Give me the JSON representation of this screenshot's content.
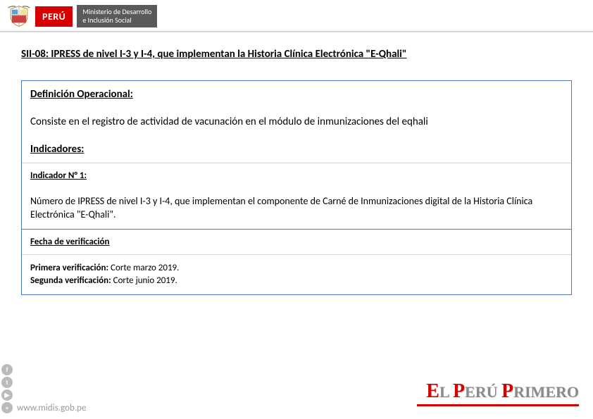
{
  "header": {
    "country": "PERÚ",
    "ministry_line1": "Ministerio de Desarrollo",
    "ministry_line2": "e Inclusión Social"
  },
  "title": "SII-08: IPRESS de nivel I-3 y I-4, que implementan la Historia Clínica Electrónica \"E-Qhali\"",
  "definicion": {
    "heading": "Definición Operacional:",
    "text": "Consiste en el registro de actividad de vacunación en el módulo de inmunizaciones del eqhali"
  },
  "indicadores": {
    "heading": "Indicadores:",
    "n1_label": "Indicador N° 1:",
    "n1_text": "Número de IPRESS de nivel I-3 y I-4, que implementan el componente de Carné de Inmunizaciones digital de la Historia Clínica Electrónica \"E-Qhali\"."
  },
  "fecha": {
    "heading": "Fecha de verificación",
    "primera_label": "Primera verificación:",
    "primera_value": " Corte marzo 2019.",
    "segunda_label": "Segunda verificación:",
    "segunda_value": " Corte junio 2019."
  },
  "footer": {
    "url": "www.midis.gob.pe",
    "slogan_el": "E",
    "slogan_l": "L ",
    "slogan_p1": "P",
    "slogan_eru": "ERÚ ",
    "slogan_p2": "P",
    "slogan_rimero": "RIMERO"
  }
}
